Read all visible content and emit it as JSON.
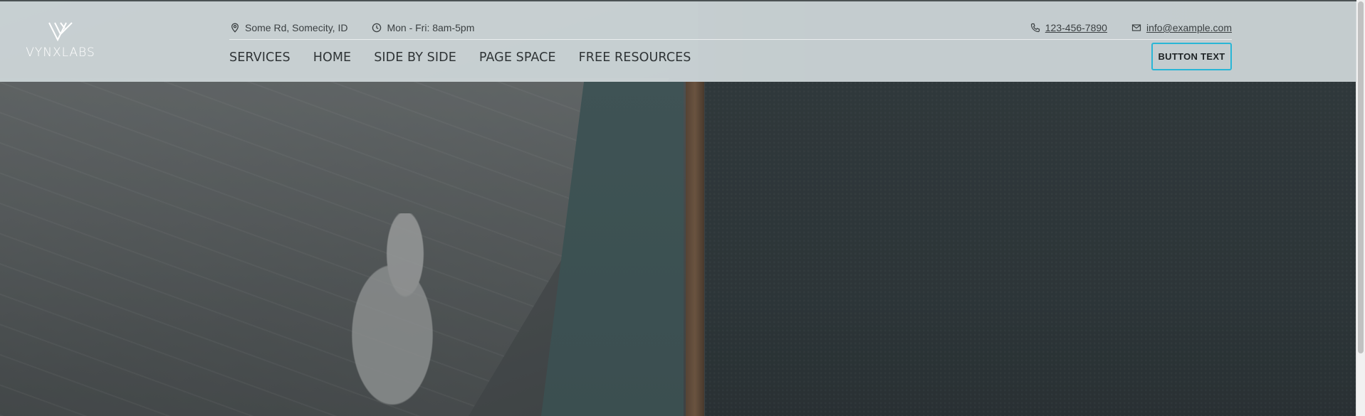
{
  "brand": {
    "name": "VYNXLABS"
  },
  "topbar": {
    "address": "Some Rd, Somecity, ID",
    "hours": "Mon - Fri: 8am-5pm",
    "phone": "123-456-7890",
    "email": "info@example.com"
  },
  "nav": {
    "items": [
      "SERVICES",
      "HOME",
      "SIDE BY SIDE",
      "PAGE SPACE",
      "FREE RESOURCES"
    ]
  },
  "cta": {
    "label": "BUTTON TEXT"
  },
  "colors": {
    "header_bg": "#d0d8da",
    "cta_border": "#29b6d6",
    "text_dark": "#2f3436"
  },
  "icons": {
    "address": "map-pin-icon",
    "hours": "clock-icon",
    "phone": "phone-icon",
    "email": "mail-icon"
  }
}
